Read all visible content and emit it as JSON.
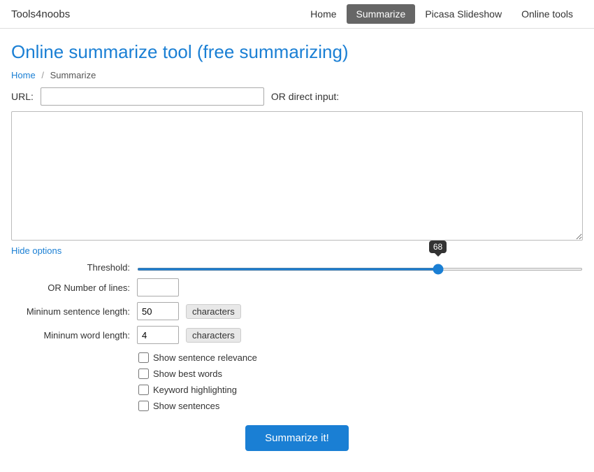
{
  "nav": {
    "logo": "Tools4noobs",
    "links": [
      {
        "label": "Home",
        "active": false
      },
      {
        "label": "Summarize",
        "active": true
      },
      {
        "label": "Picasa Slideshow",
        "active": false
      },
      {
        "label": "Online tools",
        "active": false
      }
    ]
  },
  "header": {
    "title": "Online summarize tool (free summarizing)"
  },
  "breadcrumb": {
    "home": "Home",
    "separator": "/",
    "current": "Summarize"
  },
  "form": {
    "url_label": "URL:",
    "url_placeholder": "",
    "direct_input_label": "OR direct input:",
    "textarea_placeholder": "",
    "hide_options_label": "Hide options",
    "threshold_label": "Threshold:",
    "threshold_value": 68,
    "number_of_lines_label": "OR Number of lines:",
    "number_of_lines_value": "",
    "min_sentence_label": "Mininum sentence length:",
    "min_sentence_value": "50",
    "min_sentence_unit": "characters",
    "min_word_label": "Mininum word length:",
    "min_word_value": "4",
    "min_word_unit": "characters",
    "checkboxes": [
      {
        "label": "Show sentence relevance",
        "checked": false
      },
      {
        "label": "Show best words",
        "checked": false
      },
      {
        "label": "Keyword highlighting",
        "checked": false
      },
      {
        "label": "Show sentences",
        "checked": false
      }
    ],
    "submit_label": "Summarize it!"
  }
}
